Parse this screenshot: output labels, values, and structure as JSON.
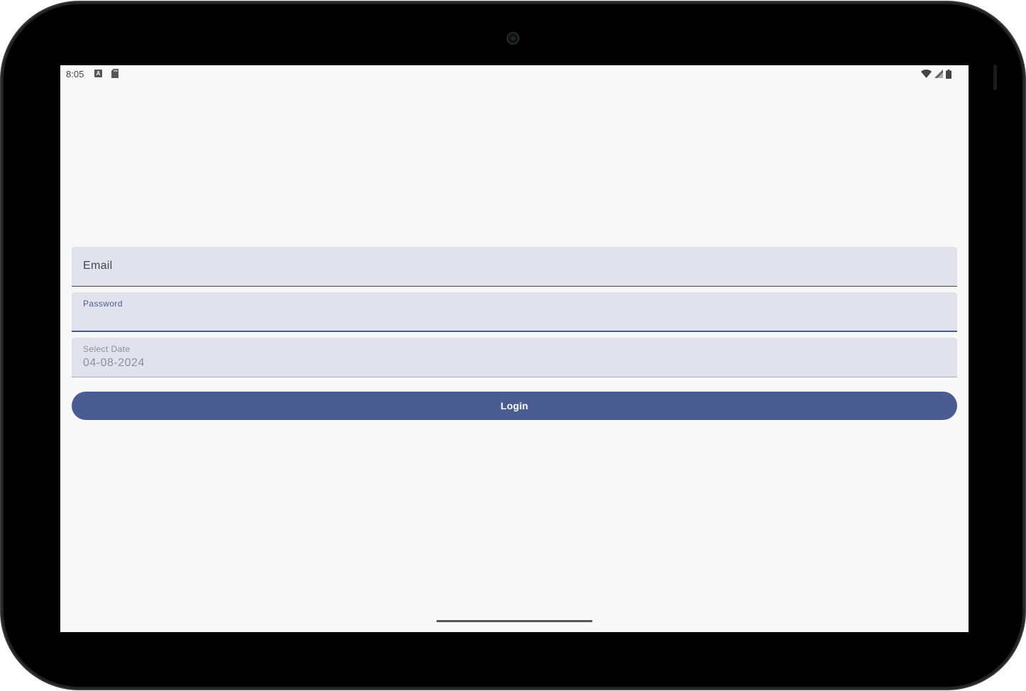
{
  "status_bar": {
    "time": "8:05",
    "notification_icons": [
      "a-box-icon",
      "sd-card-icon"
    ],
    "system_icons": [
      "wifi-icon",
      "signal-icon",
      "battery-icon"
    ]
  },
  "login_form": {
    "email": {
      "label": "Email",
      "value": ""
    },
    "password": {
      "label": "Password",
      "value": "",
      "focused": true
    },
    "date": {
      "label": "Select Date",
      "value": "04-08-2024",
      "enabled": false
    },
    "login_button_label": "Login"
  },
  "colors": {
    "primary": "#4a5c92",
    "field_background": "#e2e2ec",
    "screen_background": "#f8f8f9"
  }
}
